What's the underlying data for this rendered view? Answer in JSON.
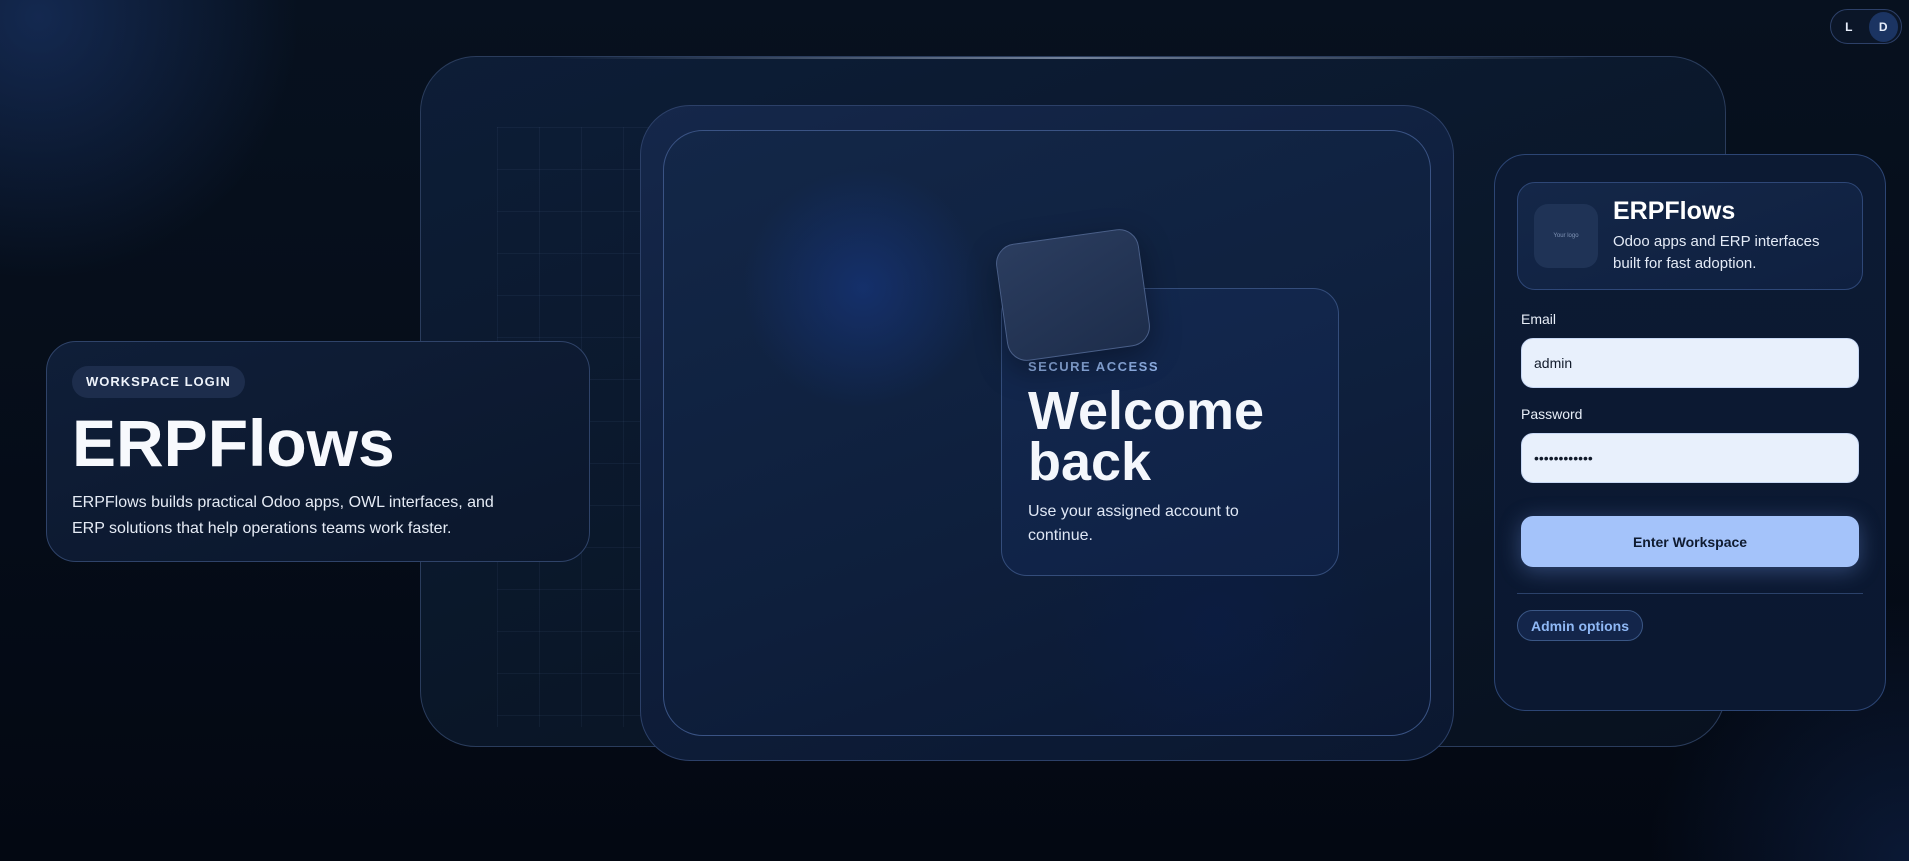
{
  "theme_toggle": {
    "light_label": "L",
    "dark_label": "D",
    "active": "D"
  },
  "intro": {
    "badge": "WORKSPACE LOGIN",
    "title": "ERPFlows",
    "description": "ERPFlows builds practical Odoo apps, OWL interfaces, and ERP solutions that help operations teams work faster."
  },
  "welcome": {
    "eyebrow": "SECURE ACCESS",
    "title": "Welcome back",
    "subtitle": "Use your assigned account to continue."
  },
  "login": {
    "brand": {
      "logo_text": "Your logo",
      "name": "ERPFlows",
      "tagline": "Odoo apps and ERP interfaces built for fast adoption."
    },
    "email_label": "Email",
    "email_value": "admin",
    "password_label": "Password",
    "password_value": "••••••••••••",
    "submit_label": "Enter Workspace",
    "admin_label": "Admin options"
  },
  "colors": {
    "background": "#050c18",
    "accent": "#a4c3fa",
    "link": "#8fb8f5",
    "input_bg": "#e8f0fc"
  }
}
